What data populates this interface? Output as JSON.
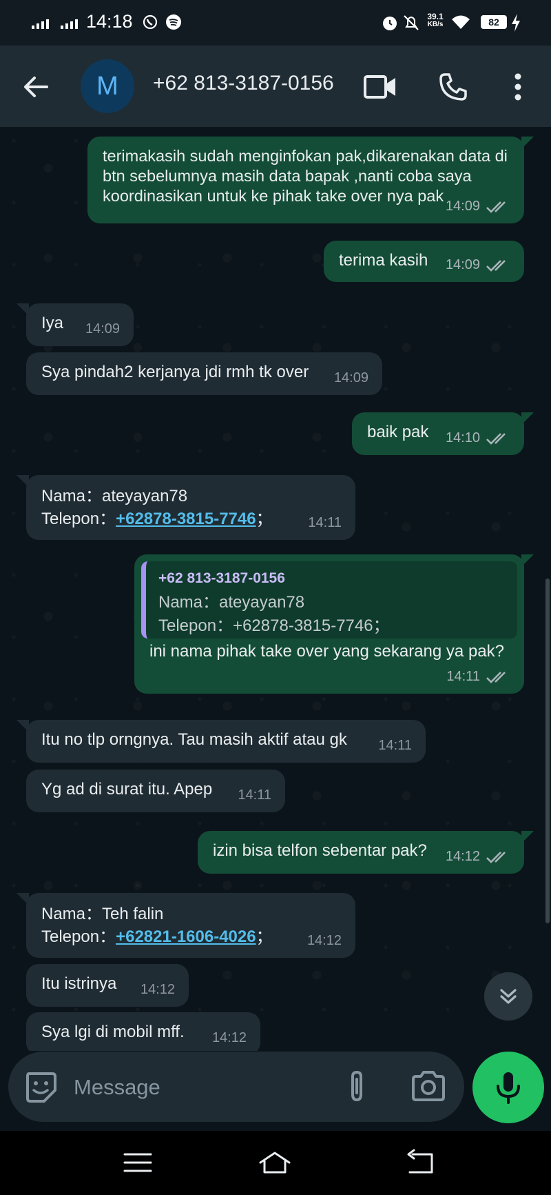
{
  "status_bar": {
    "time": "14:18",
    "net_speed_value": "39.1",
    "net_speed_unit": "KB/s",
    "battery": "82"
  },
  "header": {
    "avatar_letter": "M",
    "contact": "+62 813-3187-0156"
  },
  "messages": [
    {
      "dir": "out",
      "text": "terimakasih sudah menginfokan pak,dikarenakan data di btn sebelumnya masih data bapak ,nanti coba saya koordinasikan untuk ke pihak take over nya pak",
      "time": "14:09"
    },
    {
      "dir": "out",
      "text": "terima kasih",
      "time": "14:09"
    },
    {
      "dir": "in",
      "text": "Iya",
      "time": "14:09"
    },
    {
      "dir": "in",
      "text": "Sya pindah2 kerjanya jdi rmh tk over",
      "time": "14:09"
    },
    {
      "dir": "out",
      "text": "baik pak",
      "time": "14:10"
    },
    {
      "dir": "in",
      "name_label": "Nama：ateyayan78",
      "phone_label": "Telepon：",
      "phone_link": "+62878-3815-7746",
      "phone_suffix": "；",
      "time": "14:11"
    },
    {
      "dir": "out",
      "quote_name": "+62 813-3187-0156",
      "quote_line1": "Nama：ateyayan78",
      "quote_line2": "Telepon：+62878-3815-7746；",
      "text": "ini nama pihak take over yang sekarang ya pak?",
      "time": "14:11"
    },
    {
      "dir": "in",
      "text": "Itu no tlp orngnya. Tau masih aktif atau gk",
      "time": "14:11"
    },
    {
      "dir": "in",
      "text": "Yg ad di surat itu. Apep",
      "time": "14:11"
    },
    {
      "dir": "out",
      "text": "izin bisa telfon sebentar pak?",
      "time": "14:12"
    },
    {
      "dir": "in",
      "name_label": "Nama：Teh falin",
      "phone_label": "Telepon：",
      "phone_link": "+62821-1606-4026",
      "phone_suffix": "；",
      "time": "14:12"
    },
    {
      "dir": "in",
      "text": "Itu istrinya",
      "time": "14:12"
    },
    {
      "dir": "in",
      "text": "Sya lgi di mobil mff.",
      "time": "14:12"
    }
  ],
  "input": {
    "placeholder": "Message"
  },
  "colors": {
    "outgoing_bubble": "#144d37",
    "incoming_bubble": "#202c33",
    "link": "#53bdeb",
    "mic_button": "#21c063",
    "quote_bar": "#a791f2"
  }
}
